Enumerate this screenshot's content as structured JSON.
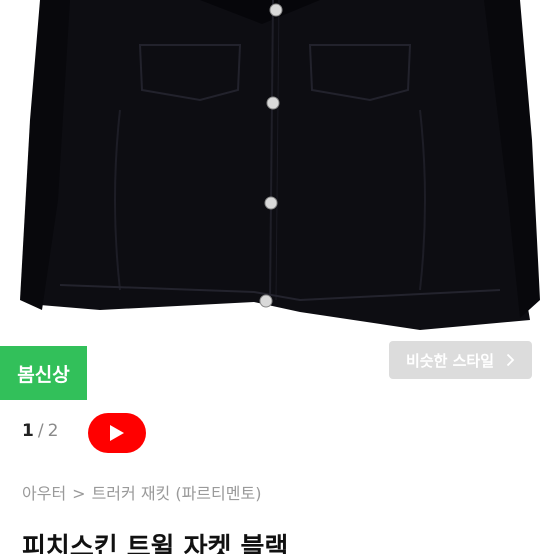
{
  "product": {
    "image_alt": "Black twill jacket",
    "badge": "봄신상",
    "similar_button": "비슷한 스타일",
    "pager": {
      "current": "1",
      "separator": "/",
      "total": "2"
    },
    "breadcrumb": {
      "category": "아우터",
      "separator": ">",
      "item": "트러커 재킷 (파르티멘토)"
    },
    "title": "피치스킨 트윌 자켓 블랙"
  },
  "colors": {
    "badge_green": "#32c05a",
    "video_red": "#ff0000",
    "similar_bg": "#dcdcdc",
    "jacket": "#0d0d12"
  },
  "icons": {
    "video": "play-icon",
    "similar": "chevron-right-icon"
  }
}
